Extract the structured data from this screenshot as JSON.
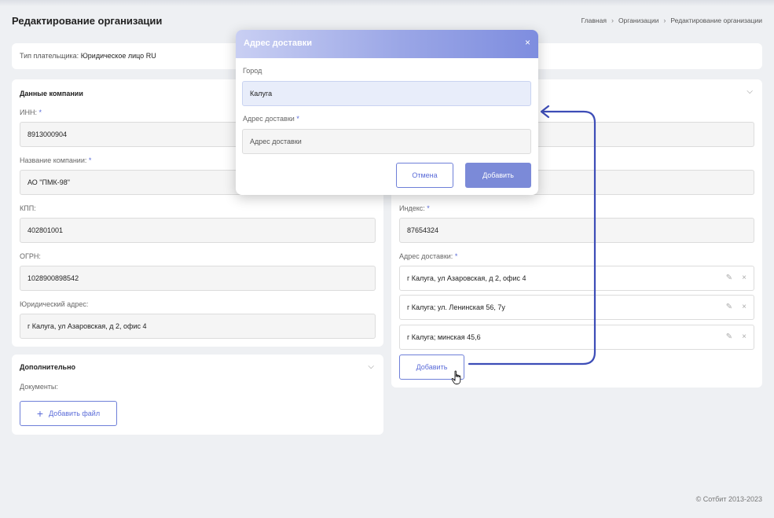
{
  "header": {
    "title": "Редактирование организации",
    "breadcrumbs": [
      "Главная",
      "Организации",
      "Редактирование организации"
    ],
    "separator": "›"
  },
  "payer": {
    "label": "Тип плательщика:",
    "value": "Юридическое лицо RU"
  },
  "company": {
    "title": "Данные компании",
    "inn_label": "ИНН:",
    "inn_value": "8913000904",
    "name_label": "Название компании:",
    "name_value": "АО \"ПМК-98\"",
    "kpp_label": "КПП:",
    "kpp_value": "402801001",
    "ogrn_label": "ОГРН:",
    "ogrn_value": "1028900898542",
    "legal_label": "Юридический адрес:",
    "legal_value": "г Калуга, ул Азаровская, д 2, офис 4",
    "required_mark": "*"
  },
  "contacts": {
    "index_label": "Индекс:",
    "index_value": "87654324",
    "delivery_label": "Адрес доставки:",
    "addresses": [
      "г Калуга, ул Азаровская, д 2, офис 4",
      "г Калуга; ул. Ленинская 56, 7у",
      "г Калуга; минская 45,6"
    ],
    "add_button": "Добавить"
  },
  "extra": {
    "title": "Дополнительно",
    "docs_label": "Документы:",
    "add_file_button": "Добавить файл",
    "plus": "+"
  },
  "modal": {
    "title": "Адрес доставки",
    "close": "×",
    "city_label": "Город",
    "city_value": "Калуга",
    "address_label": "Адрес доставки",
    "address_placeholder": "Адрес доставки",
    "cancel": "Отмена",
    "submit": "Добавить"
  },
  "footer": {
    "copyright": "© Сотбит 2013-2023"
  },
  "icons": {
    "chevron": "⌵",
    "edit": "✎",
    "remove": "×"
  },
  "colors": {
    "accent": "#5a6bd8",
    "arrow": "#3d4db7",
    "button_fill": "#7b8ad8"
  }
}
